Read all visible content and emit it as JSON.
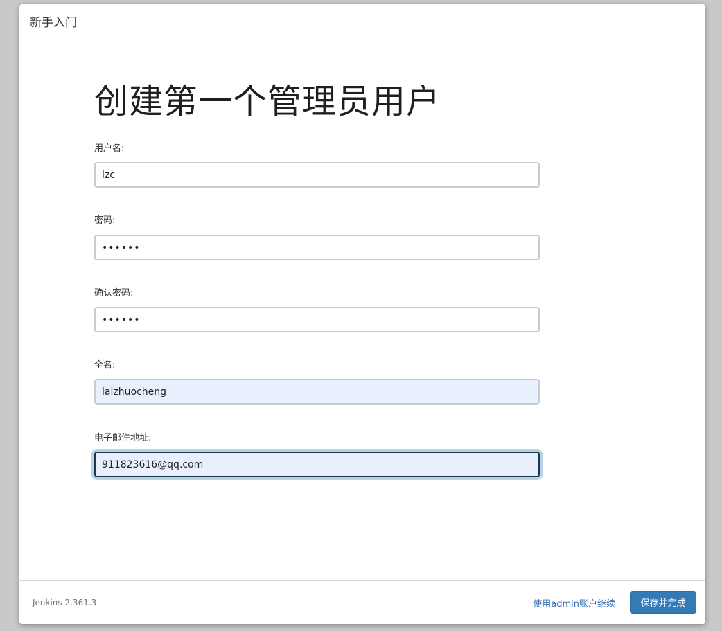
{
  "dialog": {
    "title": "新手入门"
  },
  "form": {
    "heading": "创建第一个管理员用户",
    "username": {
      "label": "用户名:",
      "value": "lzc"
    },
    "password": {
      "label": "密码:",
      "value": "••••••"
    },
    "confirm_password": {
      "label": "确认密码:",
      "value": "••••••"
    },
    "fullname": {
      "label": "全名:",
      "value": "laizhuocheng"
    },
    "email": {
      "label": "电子邮件地址:",
      "value": "911823616@qq.com"
    }
  },
  "footer": {
    "version": "Jenkins 2.361.3",
    "continue_link": "使用admin账户继续",
    "save_button": "保存并完成"
  },
  "colors": {
    "primary_button": "#337ab7",
    "link": "#3b73b4",
    "focus_border": "#1a3850",
    "autofill_background": "#e8f0fe"
  }
}
